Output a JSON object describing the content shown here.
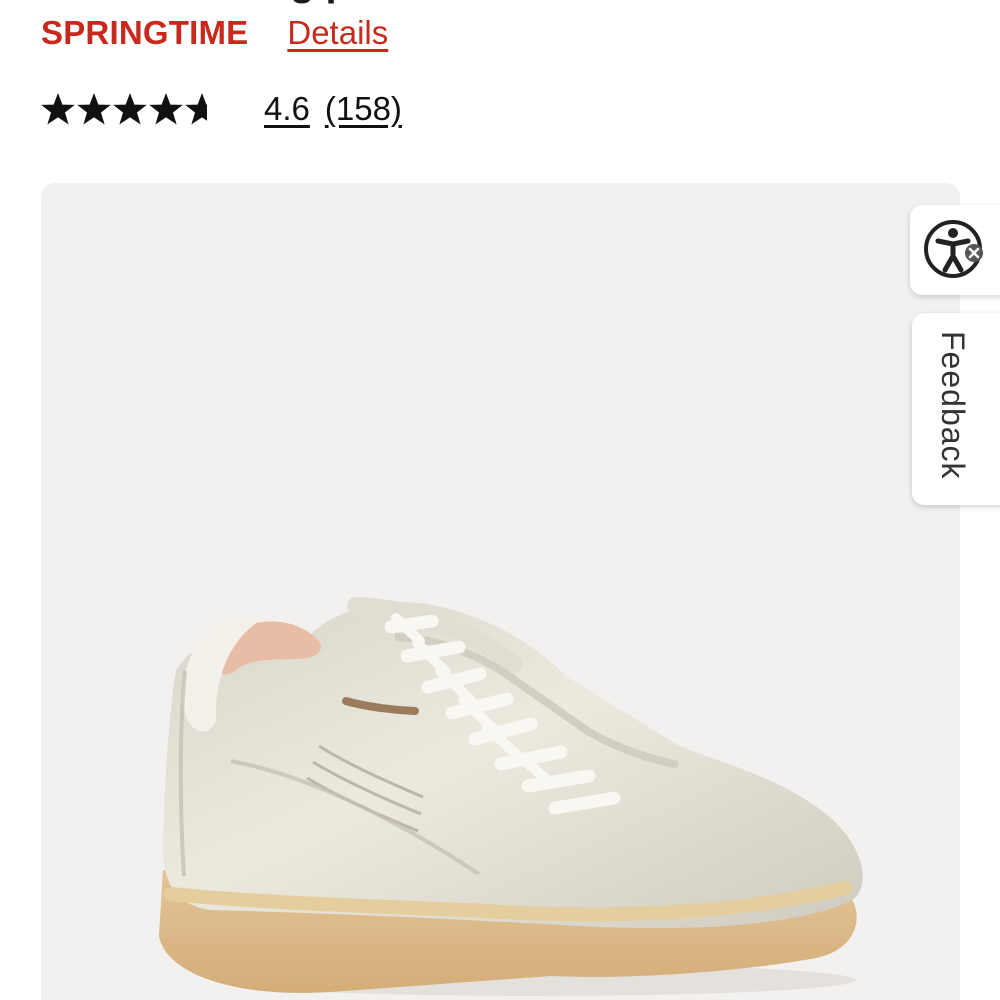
{
  "product": {
    "title_fragment": "g p",
    "promo_label": "SPRINGTIME",
    "promo_link": "Details",
    "rating": {
      "stars_value": 4.6,
      "value_text": "4.6",
      "count_text": "(158)"
    }
  },
  "image": {
    "icon": "sneaker-image",
    "background_color": "#f2f1f0"
  },
  "side_tabs": {
    "accessibility_icon": "accessibility-icon",
    "feedback_label": "Feedback"
  },
  "colors": {
    "promo": "#c8291c",
    "text": "#111111"
  }
}
